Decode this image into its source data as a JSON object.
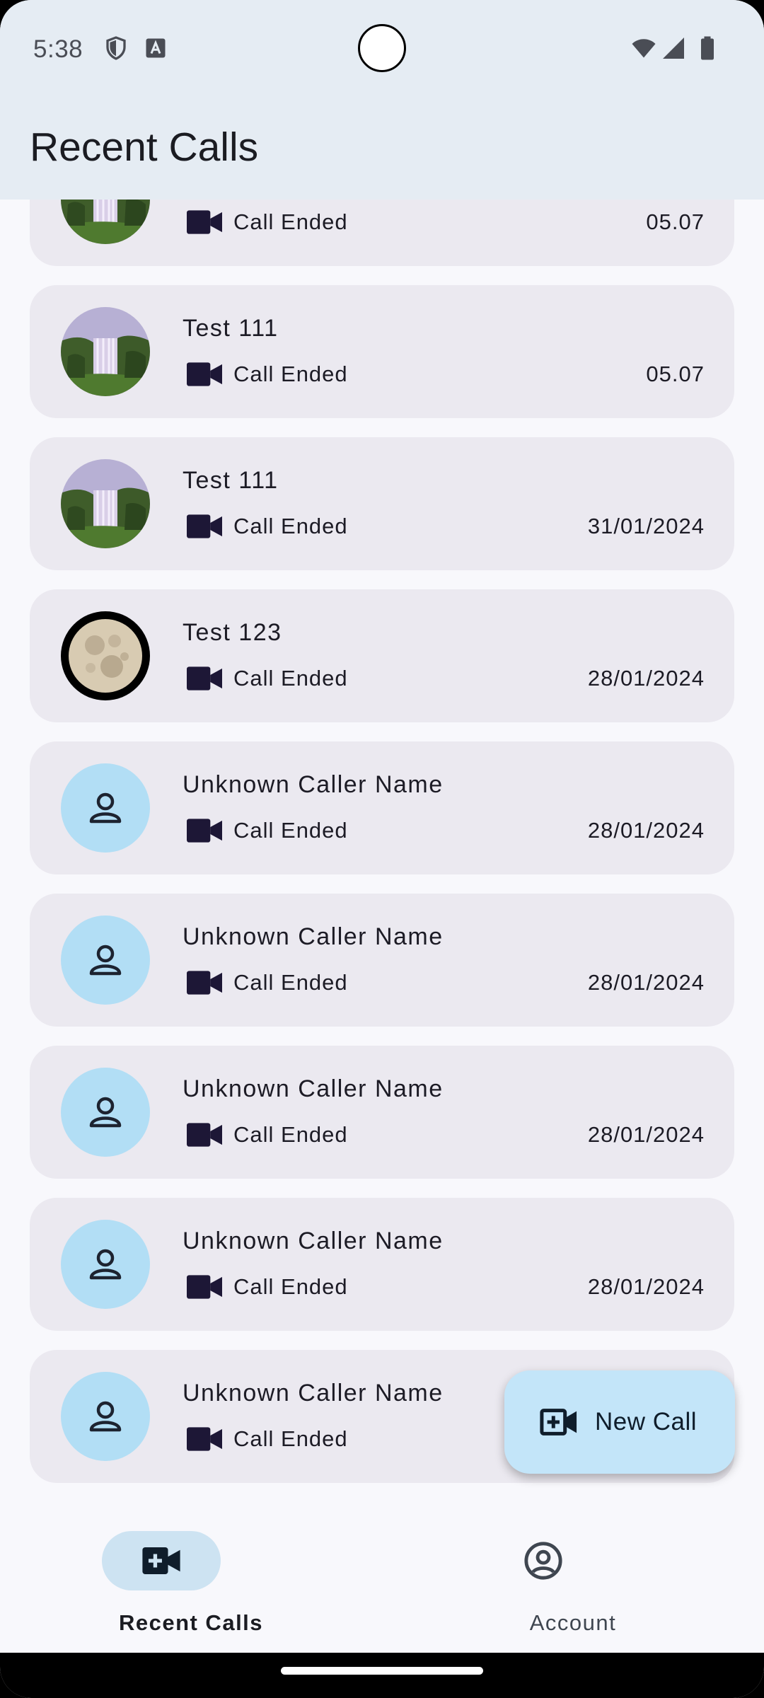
{
  "status_bar": {
    "time": "5:38",
    "icons": [
      "shield-icon",
      "a-box-icon",
      "wifi-icon",
      "signal-icon",
      "battery-icon"
    ]
  },
  "app_bar": {
    "title": "Recent Calls"
  },
  "calls": [
    {
      "name": "",
      "status": "Call Ended",
      "date": "05.07",
      "avatar": "waterfall"
    },
    {
      "name": "Test 111",
      "status": "Call Ended",
      "date": "05.07",
      "avatar": "waterfall"
    },
    {
      "name": "Test 111",
      "status": "Call Ended",
      "date": "31/01/2024",
      "avatar": "waterfall"
    },
    {
      "name": "Test 123",
      "status": "Call Ended",
      "date": "28/01/2024",
      "avatar": "moon"
    },
    {
      "name": "Unknown Caller Name",
      "status": "Call Ended",
      "date": "28/01/2024",
      "avatar": "person"
    },
    {
      "name": "Unknown Caller Name",
      "status": "Call Ended",
      "date": "28/01/2024",
      "avatar": "person"
    },
    {
      "name": "Unknown Caller Name",
      "status": "Call Ended",
      "date": "28/01/2024",
      "avatar": "person"
    },
    {
      "name": "Unknown Caller Name",
      "status": "Call Ended",
      "date": "28/01/2024",
      "avatar": "person"
    },
    {
      "name": "Unknown Caller Name",
      "status": "Call Ended",
      "date": "",
      "avatar": "person"
    }
  ],
  "fab": {
    "label": "New Call",
    "icon": "video-add-icon"
  },
  "bottom_nav": {
    "items": [
      {
        "label": "Recent Calls",
        "icon": "video-add-icon",
        "active": true
      },
      {
        "label": "Account",
        "icon": "account-circle-icon",
        "active": false
      }
    ]
  },
  "colors": {
    "top_bar": "#e5ecf3",
    "card": "#ebe9f0",
    "person_avatar": "#b2def5",
    "fab": "#c3e5f9",
    "nav_active_pill": "#cde3f2",
    "icon_dark": "#1d1736"
  }
}
